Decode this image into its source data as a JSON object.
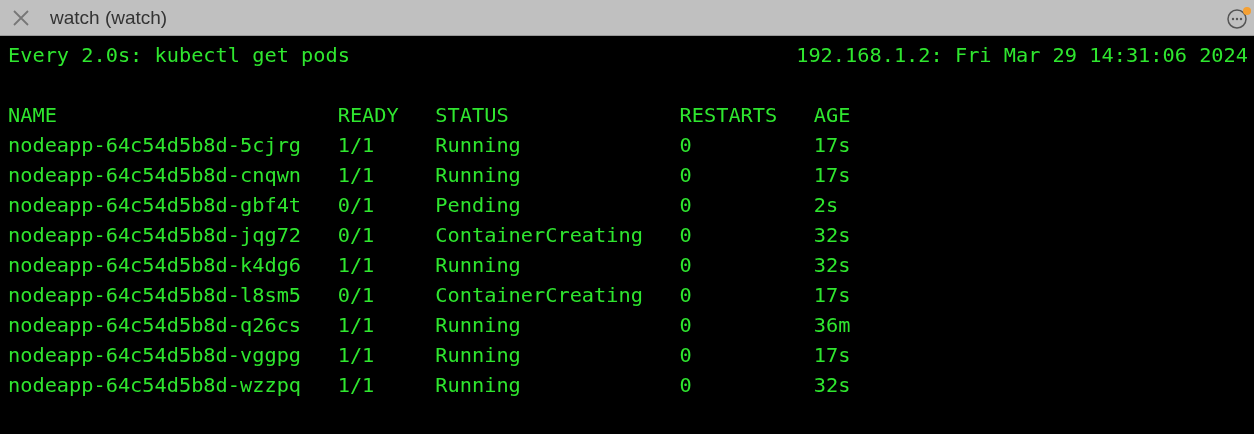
{
  "window": {
    "title": "watch (watch)"
  },
  "header": {
    "command": "Every 2.0s: kubectl get pods",
    "host_time": "192.168.1.2: Fri Mar 29 14:31:06 2024"
  },
  "table": {
    "columns": [
      "NAME",
      "READY",
      "STATUS",
      "RESTARTS",
      "AGE"
    ],
    "rows": [
      [
        "nodeapp-64c54d5b8d-5cjrg",
        "1/1",
        "Running",
        "0",
        "17s"
      ],
      [
        "nodeapp-64c54d5b8d-cnqwn",
        "1/1",
        "Running",
        "0",
        "17s"
      ],
      [
        "nodeapp-64c54d5b8d-gbf4t",
        "0/1",
        "Pending",
        "0",
        "2s"
      ],
      [
        "nodeapp-64c54d5b8d-jqg72",
        "0/1",
        "ContainerCreating",
        "0",
        "32s"
      ],
      [
        "nodeapp-64c54d5b8d-k4dg6",
        "1/1",
        "Running",
        "0",
        "32s"
      ],
      [
        "nodeapp-64c54d5b8d-l8sm5",
        "0/1",
        "ContainerCreating",
        "0",
        "17s"
      ],
      [
        "nodeapp-64c54d5b8d-q26cs",
        "1/1",
        "Running",
        "0",
        "36m"
      ],
      [
        "nodeapp-64c54d5b8d-vggpg",
        "1/1",
        "Running",
        "0",
        "17s"
      ],
      [
        "nodeapp-64c54d5b8d-wzzpq",
        "1/1",
        "Running",
        "0",
        "32s"
      ]
    ]
  }
}
